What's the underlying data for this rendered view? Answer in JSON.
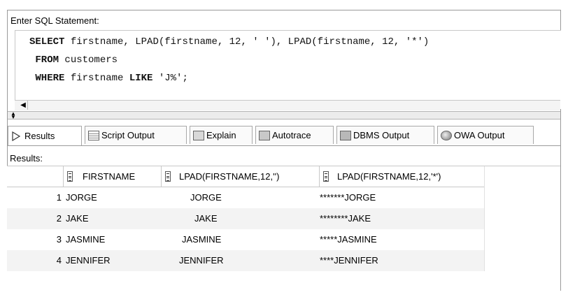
{
  "editor": {
    "label": "Enter SQL Statement:",
    "lines": [
      {
        "kw": "SELECT",
        "rest": " firstname, LPAD(firstname, 12, ' '), LPAD(firstname, 12, '*')"
      },
      {
        "kw": "FROM",
        "rest": " customers"
      },
      {
        "kw": "WHERE",
        "rest": " firstname ",
        "kw2": "LIKE",
        "rest2": " 'J%';"
      }
    ]
  },
  "tabs": [
    {
      "label": "Results",
      "icon": "play-icon"
    },
    {
      "label": "Script Output",
      "icon": "script-icon"
    },
    {
      "label": "Explain",
      "icon": "explain-icon"
    },
    {
      "label": "Autotrace",
      "icon": "autotrace-icon"
    },
    {
      "label": "DBMS Output",
      "icon": "dbms-icon"
    },
    {
      "label": "OWA Output",
      "icon": "owa-icon"
    }
  ],
  "results": {
    "label": "Results:",
    "columns": [
      "FIRSTNAME",
      "LPAD(FIRSTNAME,12,'')",
      "LPAD(FIRSTNAME,12,'*')"
    ],
    "rows": [
      {
        "n": "1",
        "c1": "JORGE",
        "c2": "JORGE",
        "c3": "*******JORGE"
      },
      {
        "n": "2",
        "c1": "JAKE",
        "c2": "JAKE",
        "c3": "********JAKE"
      },
      {
        "n": "3",
        "c1": "JASMINE",
        "c2": "JASMINE",
        "c3": "*****JASMINE"
      },
      {
        "n": "4",
        "c1": "JENNIFER",
        "c2": "JENNIFER",
        "c3": "****JENNIFER"
      }
    ]
  }
}
